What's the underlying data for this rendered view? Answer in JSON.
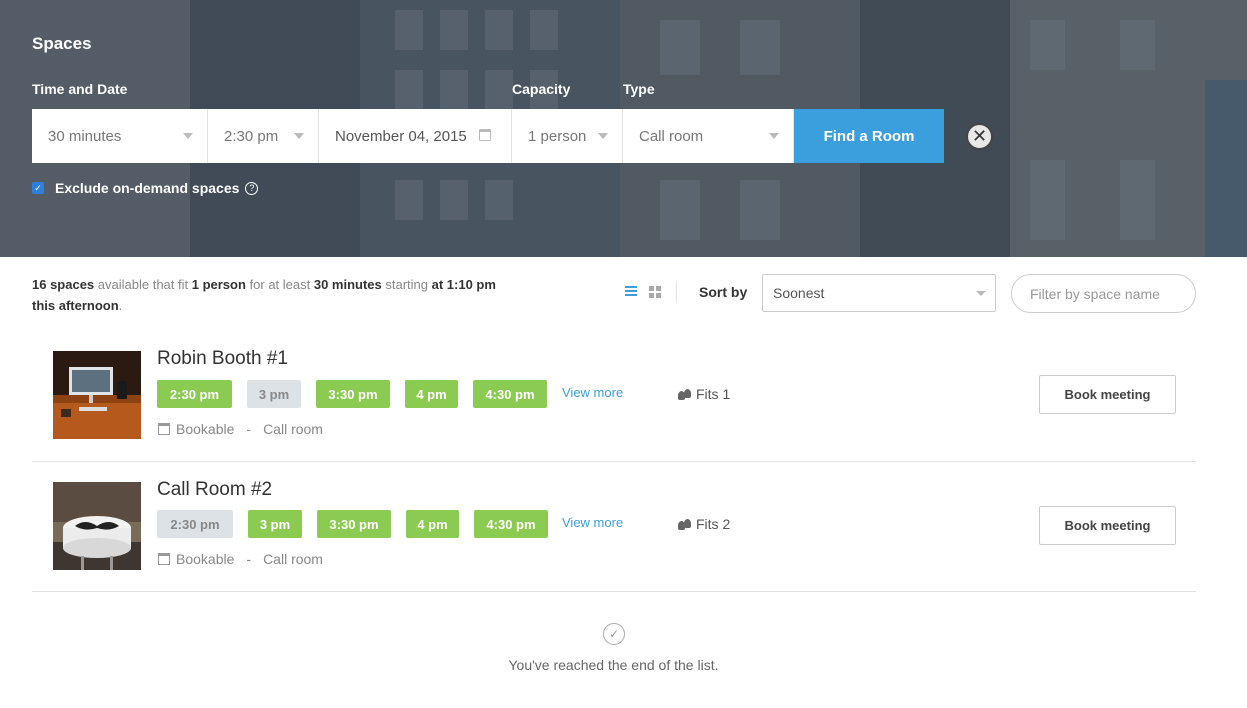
{
  "hero": {
    "title": "Spaces",
    "labels": {
      "time_date": "Time and Date",
      "capacity": "Capacity",
      "type": "Type"
    },
    "duration": "30 minutes",
    "time": "2:30 pm",
    "date": "November 04, 2015",
    "capacity": "1 person",
    "room_type": "Call room",
    "find_button": "Find a Room",
    "close_symbol": "✕",
    "exclude_label": "Exclude on-demand spaces",
    "exclude_checked": true,
    "help_symbol": "?"
  },
  "summary": {
    "count": "16 spaces",
    "t1": " available that fit ",
    "capacity": "1 person",
    "t2": " for at least ",
    "duration": "30 minutes",
    "t3": " starting ",
    "start": "at 1:10 pm",
    "line2": "this afternoon",
    "end": "."
  },
  "toolbar": {
    "sort_label": "Sort by",
    "sort_value": "Soonest",
    "filter_placeholder": "Filter by space name",
    "active_view": "list"
  },
  "rooms": [
    {
      "name": "Robin Booth #1",
      "slots": [
        {
          "label": "2:30 pm",
          "available": true
        },
        {
          "label": "3 pm",
          "available": false
        },
        {
          "label": "3:30 pm",
          "available": true
        },
        {
          "label": "4 pm",
          "available": true
        },
        {
          "label": "4:30 pm",
          "available": true
        }
      ],
      "view_more": "View more",
      "fits": "Fits 1",
      "bookable": "Bookable",
      "separator": "-",
      "type": "Call room",
      "book": "Book meeting"
    },
    {
      "name": "Call Room #2",
      "slots": [
        {
          "label": "2:30 pm",
          "available": false
        },
        {
          "label": "3 pm",
          "available": true
        },
        {
          "label": "3:30 pm",
          "available": true
        },
        {
          "label": "4 pm",
          "available": true
        },
        {
          "label": "4:30 pm",
          "available": true
        }
      ],
      "view_more": "View more",
      "fits": "Fits 2",
      "bookable": "Bookable",
      "separator": "-",
      "type": "Call room",
      "book": "Book meeting"
    }
  ],
  "end": {
    "check_symbol": "✓",
    "text": "You've reached the end of the list."
  },
  "colors": {
    "accent": "#3a9fdc",
    "slot_available": "#8ccb52",
    "slot_unavailable": "#dde2e6"
  },
  "icons": [
    "list-view-icon",
    "grid-view-icon",
    "calendar-icon",
    "people-icon",
    "checkmark-icon",
    "help-icon",
    "close-icon"
  ]
}
